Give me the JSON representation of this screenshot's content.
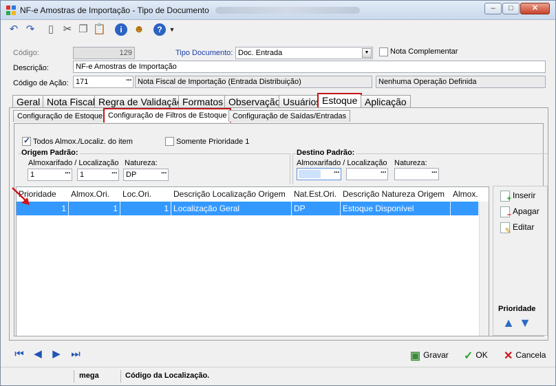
{
  "window": {
    "title": "NF-e Amostras de Importação - Tipo de Documento",
    "minimize": "–",
    "maximize": "□",
    "close": "✕"
  },
  "toolbar": {
    "undo_icon": "undo-icon",
    "redo_icon": "redo-icon",
    "new_icon": "new-document-icon",
    "cut_icon": "scissors-icon",
    "copy_icon": "copy-icon",
    "paste_icon": "paste-icon",
    "info_icon": "info-icon",
    "user_icon": "user-icon",
    "help_icon": "help-icon"
  },
  "header": {
    "codigo_label": "Código:",
    "codigo_value": "129",
    "tipo_documento_label": "Tipo Documento:",
    "tipo_documento_value": "Doc. Entrada",
    "nota_complementar_label": "Nota Complementar",
    "descricao_label": "Descrição:",
    "descricao_value": "NF-e Amostras de Importação",
    "codigo_acao_label": "Código de Ação:",
    "codigo_acao_value": "171",
    "codigo_acao_desc": "Nota Fiscal de Importação (Entrada Distribuição)",
    "operacao_value": "Nenhuma Operação Definida"
  },
  "tabs": [
    "Geral",
    "Nota Fiscal",
    "Regra de Validação",
    "Formatos",
    "Observação",
    "Usuários",
    "Estoque",
    "Aplicação"
  ],
  "subtabs": [
    "Configuração de Estoque",
    "Configuração de Filtros de Estoque",
    "Configuração de Saídas/Entradas"
  ],
  "filters": {
    "todos_label": "Todos Almox./Localiz. do item",
    "somente_label": "Somente Prioridade 1",
    "origem_title": "Origem Padrão:",
    "destino_title": "Destino Padrão:",
    "almox_loc_label": "Almoxarifado / Localização",
    "natureza_label": "Natureza:",
    "origem_almox": "1",
    "origem_loc": "1",
    "origem_nat": "DP",
    "destino_almox": "",
    "destino_loc": "",
    "destino_nat": ""
  },
  "grid": {
    "columns": [
      "Prioridade",
      "Almox.Ori.",
      "Loc.Ori.",
      "Descrição Localização Origem",
      "Nat.Est.Ori.",
      "Descrição Natureza Origem",
      "Almox."
    ],
    "rows": [
      [
        "1",
        "1",
        "1",
        "Localização Geral",
        "DP",
        "Estoque Disponível",
        ""
      ]
    ]
  },
  "side": {
    "inserir": "Inserir",
    "apagar": "Apagar",
    "editar": "Editar",
    "prioridade": "Prioridade"
  },
  "footer": {
    "gravar": "Gravar",
    "ok": "OK",
    "cancela": "Cancela"
  },
  "status": {
    "user": "mega",
    "message": "Código da Localização."
  },
  "colors": {
    "selection": "#3399ff",
    "highlight_border": "#c2151a",
    "link_blue": "#1a3fa8"
  }
}
